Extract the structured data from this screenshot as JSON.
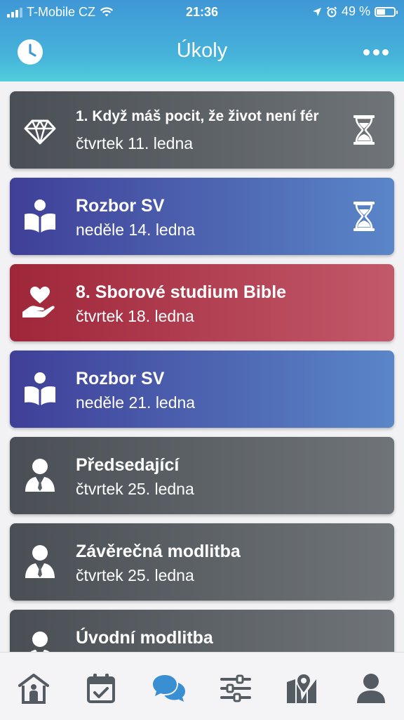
{
  "status_bar": {
    "carrier": "T-Mobile CZ",
    "time": "21:36",
    "battery": "49 %"
  },
  "header": {
    "title": "Úkoly",
    "left_icon": "clock-icon",
    "right_icon": "more-icon"
  },
  "colors": {
    "header_top": "#3f97d6",
    "header_bottom": "#52cedc",
    "gray_card": "#5b6066",
    "blue_card": "#4a5fb0",
    "red_card": "#b03a4e",
    "tab_active": "#3a8fd3",
    "tab_inactive": "#555b62"
  },
  "tasks": [
    {
      "title": "1. Když máš pocit, že život není fér",
      "date": "čtvrtek 11. ledna",
      "style": "gray",
      "icon": "diamond-icon",
      "pending": true
    },
    {
      "title": "Rozbor SV",
      "date": "neděle 14. ledna",
      "style": "blue",
      "icon": "bible-reader-icon",
      "pending": true
    },
    {
      "title": "8. Sborové studium Bible",
      "date": "čtvrtek 18. ledna",
      "style": "red",
      "icon": "heart-hand-icon",
      "pending": false
    },
    {
      "title": "Rozbor SV",
      "date": "neděle 21. ledna",
      "style": "blue",
      "icon": "bible-reader-icon",
      "pending": false
    },
    {
      "title": "Předsedající",
      "date": "čtvrtek 25. ledna",
      "style": "gray",
      "icon": "person-tie-icon",
      "pending": false
    },
    {
      "title": "Závěrečná modlitba",
      "date": "čtvrtek 25. ledna",
      "style": "gray",
      "icon": "person-tie-icon",
      "pending": false
    },
    {
      "title": "Úvodní modlitba",
      "date": "",
      "style": "gray",
      "icon": "person-tie-icon",
      "pending": false
    }
  ],
  "tabbar": {
    "items": [
      {
        "icon": "kingdom-hall-icon",
        "active": false
      },
      {
        "icon": "calendar-check-icon",
        "active": false
      },
      {
        "icon": "chat-bubbles-icon",
        "active": true
      },
      {
        "icon": "sliders-icon",
        "active": false
      },
      {
        "icon": "map-pin-icon",
        "active": false
      },
      {
        "icon": "user-icon",
        "active": false
      }
    ]
  }
}
